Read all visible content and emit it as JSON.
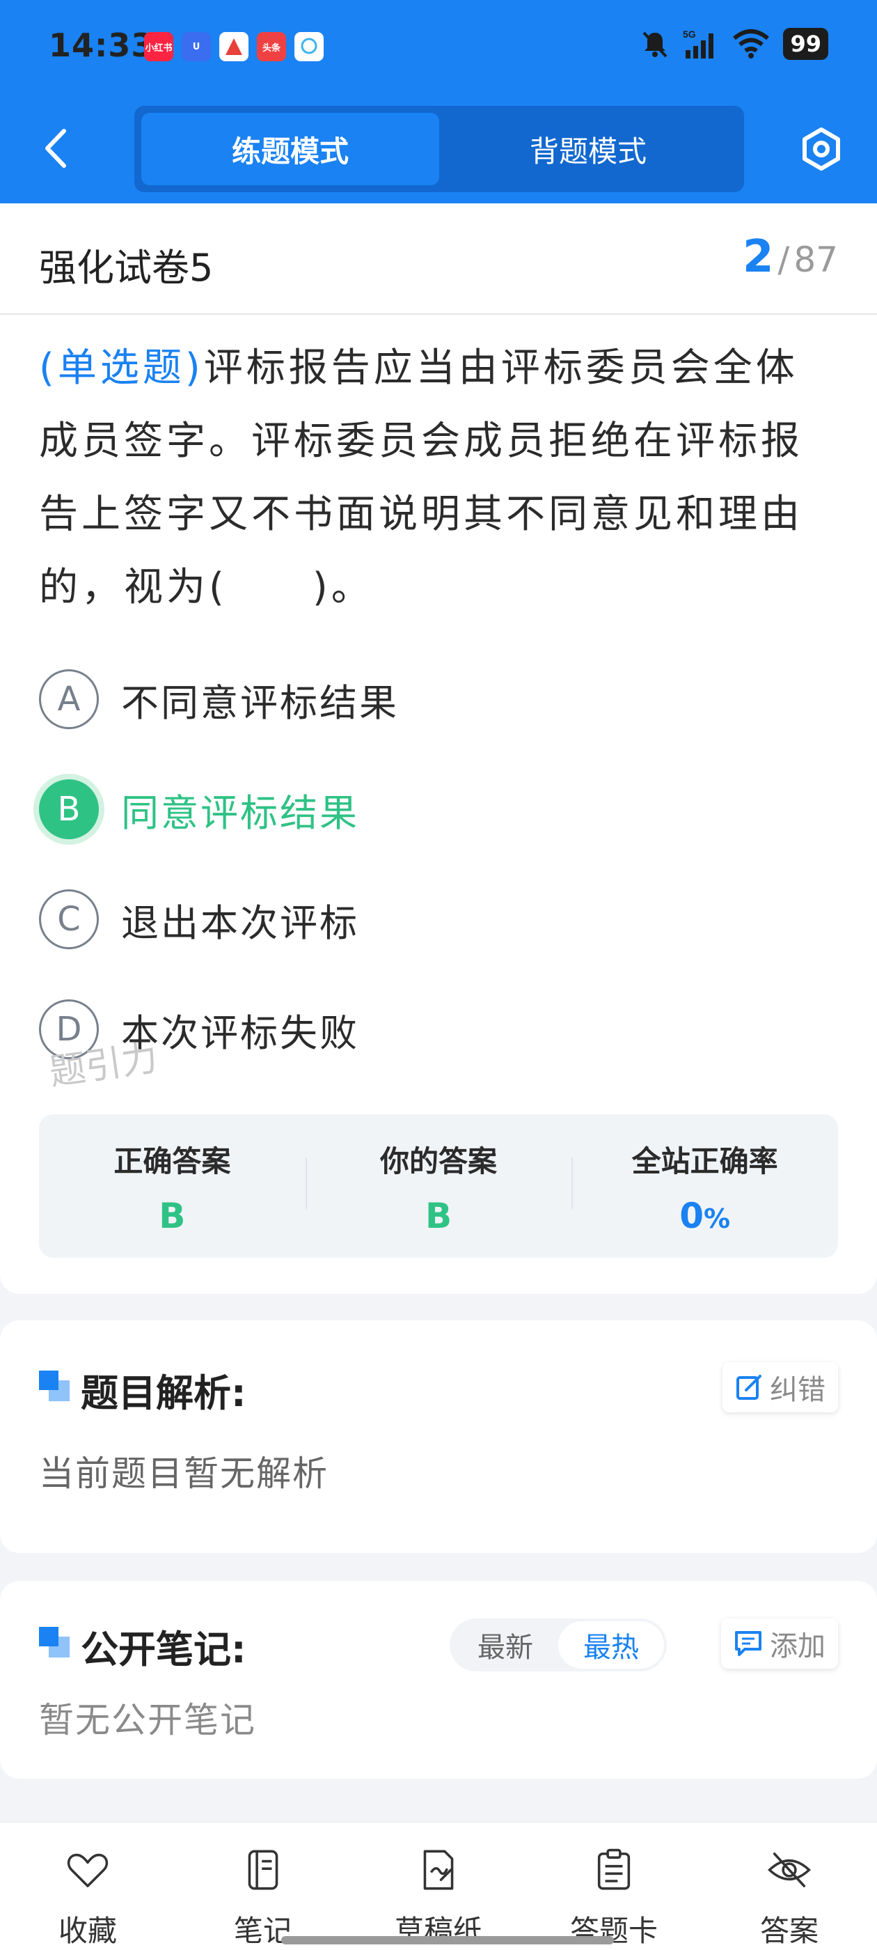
{
  "status_bar": {
    "time": "14:33",
    "battery": "99",
    "network": "5G",
    "app_icons": [
      {
        "name": "xiaohongshu",
        "label": "小红书",
        "color": "#ff2442"
      },
      {
        "name": "app-u",
        "label": "U",
        "color": "#3a6df0"
      },
      {
        "name": "app-a",
        "label": "",
        "color": "#e8403a"
      },
      {
        "name": "toutiao",
        "label": "头条",
        "color": "#f04142"
      },
      {
        "name": "chat",
        "label": "",
        "color": "#3cb4f0"
      }
    ]
  },
  "nav": {
    "modes": [
      "练题模式",
      "背题模式"
    ],
    "active_mode": "练题模式"
  },
  "paper": {
    "title": "强化试卷5",
    "current": "2",
    "separator": "/",
    "total": "87"
  },
  "question": {
    "type": "(单选题)",
    "text": "评标报告应当由评标委员会全体成员签字。评标委员会成员拒绝在评标报告上签字又不书面说明其不同意见和理由的，视为(　　)。",
    "options": [
      {
        "letter": "A",
        "text": "不同意评标结果"
      },
      {
        "letter": "B",
        "text": "同意评标结果"
      },
      {
        "letter": "C",
        "text": "退出本次评标"
      },
      {
        "letter": "D",
        "text": "本次评标失败"
      }
    ],
    "selected": "B"
  },
  "watermark": "题引力",
  "summary": {
    "correct_label": "正确答案",
    "correct_value": "B",
    "yours_label": "你的答案",
    "yours_value": "B",
    "rate_label": "全站正确率",
    "rate_value": "0",
    "rate_unit": "%"
  },
  "analysis": {
    "title": "题目解析:",
    "correction_button": "纠错",
    "body": "当前题目暂无解析"
  },
  "notes": {
    "title": "公开笔记:",
    "sort_options": [
      "最新",
      "最热"
    ],
    "active_sort": "最热",
    "add_button": "添加",
    "body": "暂无公开笔记"
  },
  "bottom_bar": {
    "items": [
      "收藏",
      "笔记",
      "草稿纸",
      "答题卡",
      "答案"
    ]
  },
  "colors": {
    "primary": "#1a82f2",
    "correct": "#2fc285"
  }
}
